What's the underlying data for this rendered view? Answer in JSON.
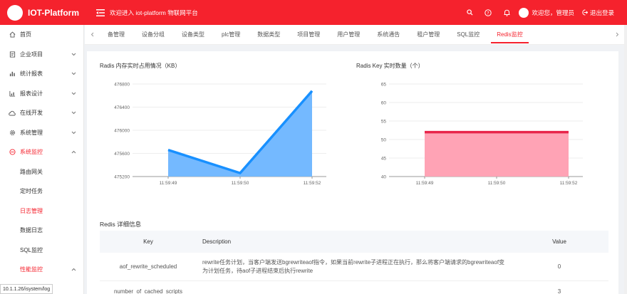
{
  "header": {
    "brand": "IOT-Platform",
    "welcome": "欢迎进入 iot-platform 物联网平台",
    "user_greeting": "欢迎您，管理员",
    "logout_label": "退出登录",
    "icons": [
      "search-icon",
      "question-icon",
      "bell-icon"
    ]
  },
  "sidebar": {
    "items": [
      {
        "label": "首页",
        "icon": "home-icon"
      },
      {
        "label": "企业项目",
        "icon": "project-icon"
      },
      {
        "label": "统计报表",
        "icon": "bar-chart-icon"
      },
      {
        "label": "报表设计",
        "icon": "chart-design-icon"
      },
      {
        "label": "在线开发",
        "icon": "cloud-icon"
      },
      {
        "label": "系统管理",
        "icon": "settings-icon"
      },
      {
        "label": "系统监控",
        "icon": "monitor-icon"
      }
    ],
    "monitor_sub": [
      {
        "label": "路由网关"
      },
      {
        "label": "定时任务"
      },
      {
        "label": "日志管理"
      },
      {
        "label": "数据日志"
      },
      {
        "label": "SQL监控"
      },
      {
        "label": "性能监控"
      }
    ],
    "status_url": "10.1.1.26/isystem/log"
  },
  "tabs": [
    "备管理",
    "设备分组",
    "设备类型",
    "plc管理",
    "数据类型",
    "项目管理",
    "用户管理",
    "系统通告",
    "租户管理",
    "SQL监控",
    "Redis监控"
  ],
  "active_tab_index": 10,
  "charts": {
    "memory_title": "Radis 内存实时占用情况（KB）",
    "keys_title": "Radis Key 实时数量（个）"
  },
  "chart_data": [
    {
      "type": "area",
      "title": "Radis 内存实时占用情况（KB）",
      "x": [
        "11:59:49",
        "11:59:50",
        "11:59:52"
      ],
      "values": [
        475660,
        475260,
        476680
      ],
      "ylim": [
        475200,
        476800
      ],
      "yticks": [
        475200,
        475600,
        476000,
        476400,
        476800
      ],
      "color": "#1890ff",
      "fill": "#74b9ff"
    },
    {
      "type": "area",
      "title": "Radis Key 实时数量（个）",
      "x": [
        "11:59:49",
        "11:59:50",
        "11:59:52"
      ],
      "values": [
        52,
        52,
        52
      ],
      "ylim": [
        40,
        65
      ],
      "yticks": [
        40,
        45,
        50,
        55,
        60,
        65
      ],
      "color": "#e8254b",
      "fill": "#ffa3b5"
    }
  ],
  "details": {
    "title": "Redis 详细信息",
    "headers": {
      "key": "Key",
      "description": "Description",
      "value": "Value"
    },
    "rows": [
      {
        "key": "aof_rewrite_scheduled",
        "description": "rewrite任务计划，当客户端发送bgrewriteaof指令，如果当前rewrite子进程正在执行，那么将客户端请求的bgrewriteaof变为计划任务，待aof子进程结束后执行rewrite",
        "value": "0"
      },
      {
        "key": "number_of_cached_scripts",
        "description": "",
        "value": "3"
      }
    ]
  },
  "colors": {
    "primary": "#f5222d"
  }
}
